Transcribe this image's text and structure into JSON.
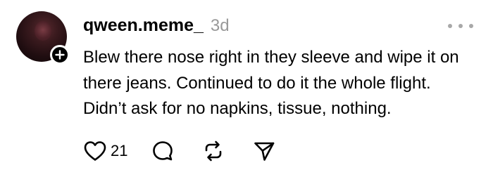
{
  "post": {
    "username": "qween.meme_",
    "timestamp": "3d",
    "text": "Blew there nose right in they sleeve and wipe it on there jeans. Continued to do it the whole flight. Didn’t ask for no napkins, tissue, nothing.",
    "likes": "21"
  },
  "icons": {
    "avatar": "profile-photo",
    "follow": "plus-icon",
    "more": "ellipsis-icon",
    "like": "heart-icon",
    "reply": "comment-bubble-icon",
    "repost": "repost-arrows-icon",
    "share": "paper-plane-icon"
  },
  "colors": {
    "text": "#000000",
    "muted": "#999999",
    "more_dots": "#a8a8a8"
  }
}
